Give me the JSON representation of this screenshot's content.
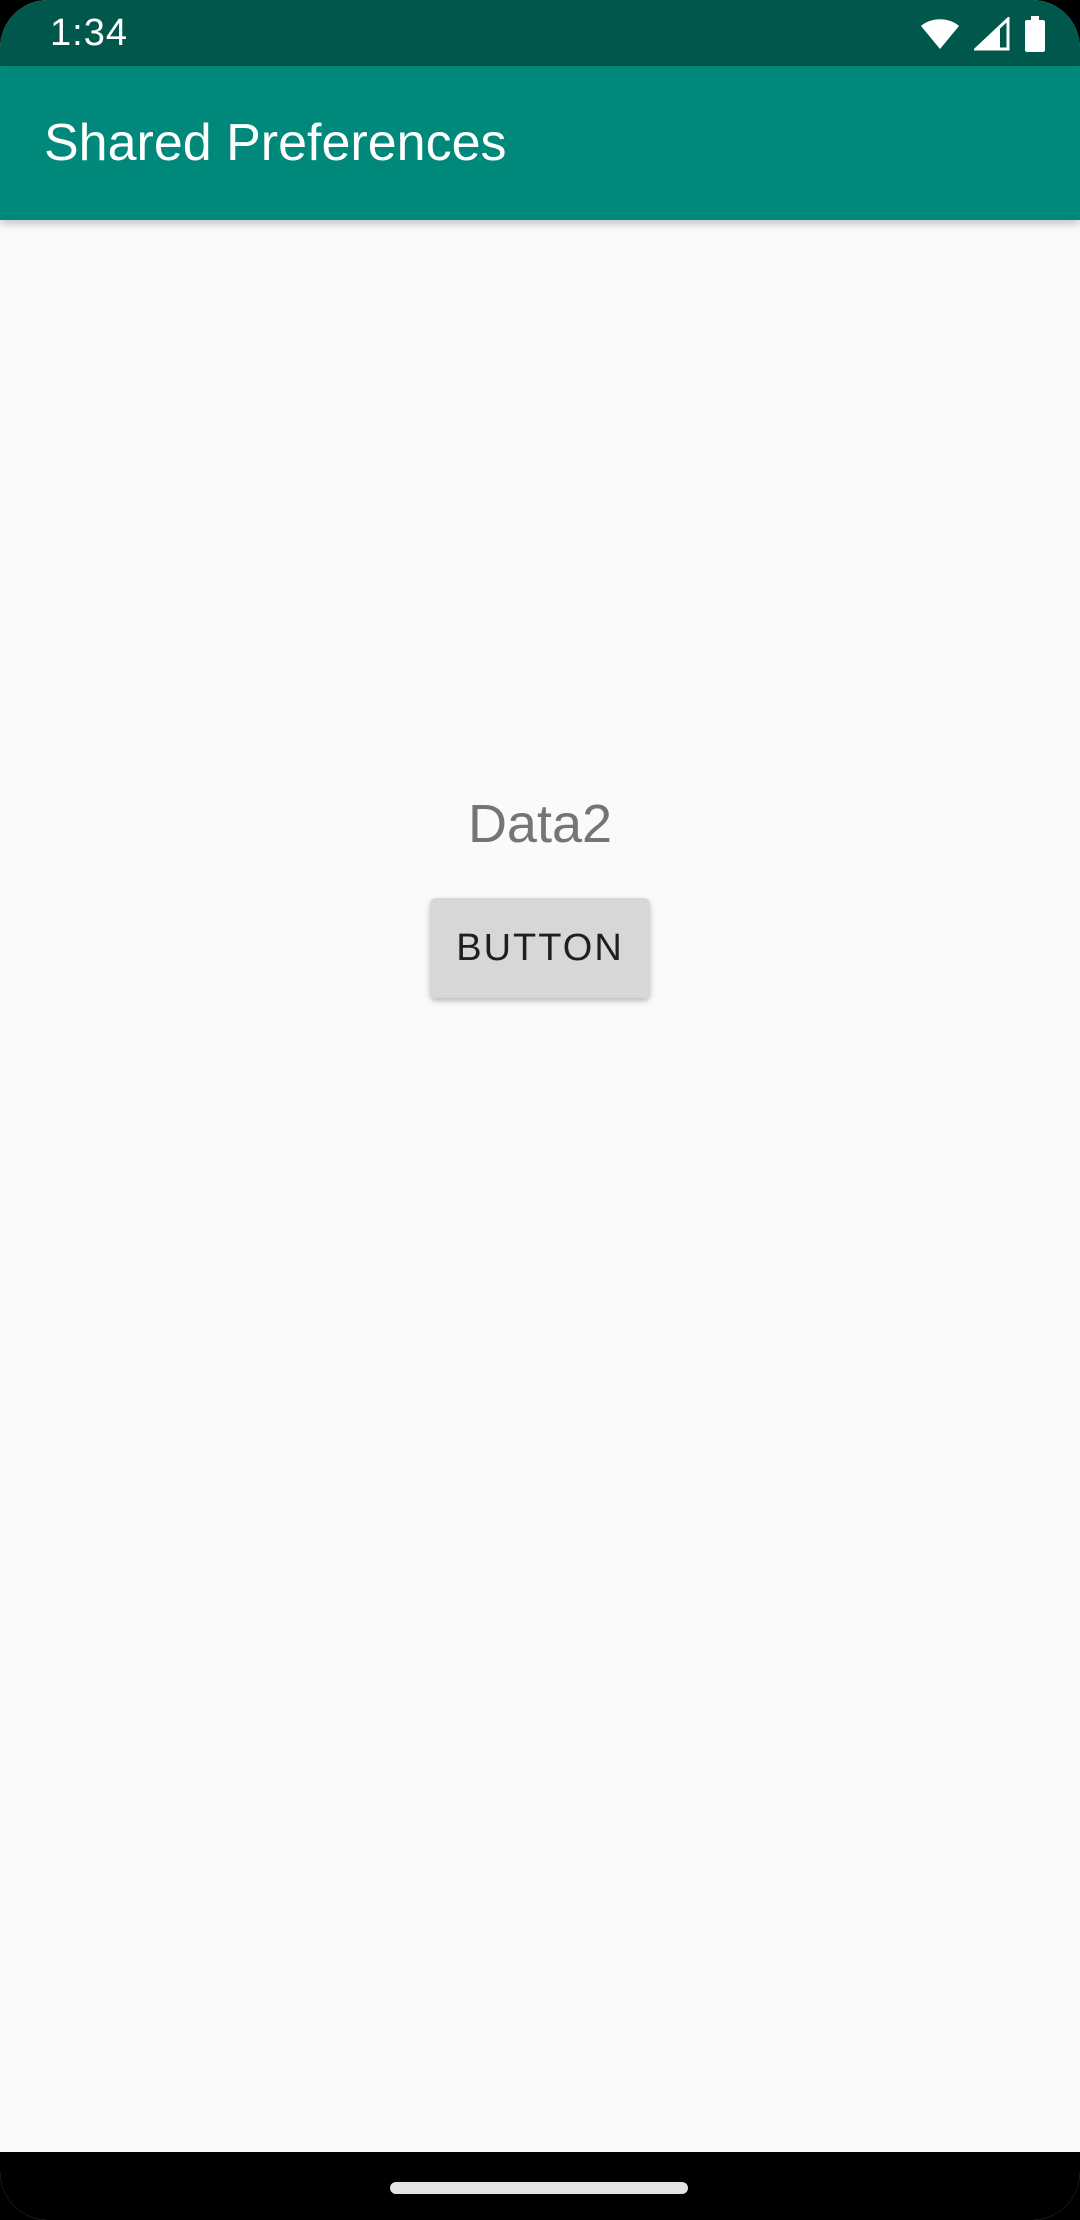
{
  "status_bar": {
    "time": "1:34",
    "icons": [
      "wifi-icon",
      "cellular-signal-icon",
      "battery-icon"
    ],
    "background": "#00574b"
  },
  "app_bar": {
    "title": "Shared Preferences",
    "background": "#00887a"
  },
  "main": {
    "data_text": "Data2",
    "button_label": "BUTTON",
    "background": "#fafafa"
  },
  "navigation": {
    "home_handle": "home-handle"
  }
}
